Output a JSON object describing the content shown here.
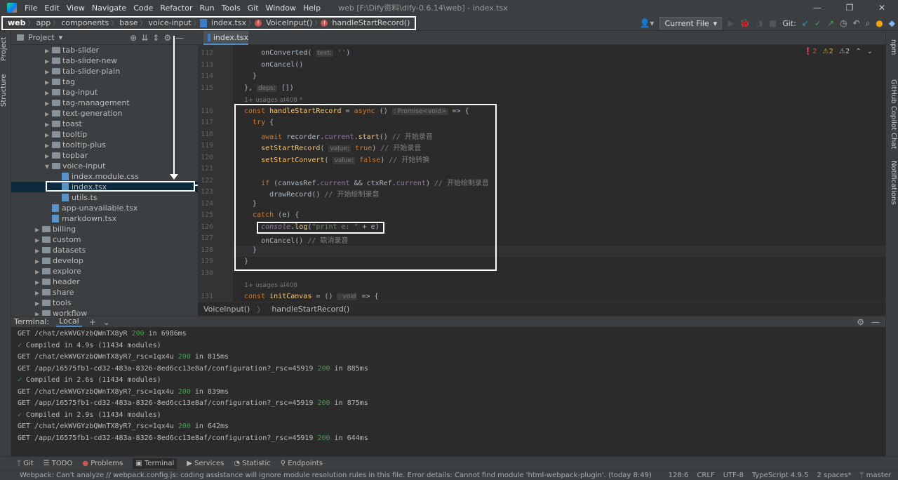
{
  "menu": [
    "File",
    "Edit",
    "View",
    "Navigate",
    "Code",
    "Refactor",
    "Run",
    "Tools",
    "Git",
    "Window",
    "Help"
  ],
  "window_title": "web [F:\\Dify资料\\dify-0.6.14\\web] - index.tsx",
  "breadcrumbs": {
    "web": "web",
    "app": "app",
    "components": "components",
    "base": "base",
    "voice": "voice-input",
    "file": "index.tsx",
    "fn1": "VoiceInput()",
    "fn2": "handleStartRecord()"
  },
  "nav_right": {
    "run_config": "Current File",
    "git_label": "Git:"
  },
  "project": {
    "header": "Project"
  },
  "tree": [
    {
      "label": "tab-slider",
      "type": "folder",
      "depth": 2
    },
    {
      "label": "tab-slider-new",
      "type": "folder",
      "depth": 2
    },
    {
      "label": "tab-slider-plain",
      "type": "folder",
      "depth": 2
    },
    {
      "label": "tag",
      "type": "folder",
      "depth": 2
    },
    {
      "label": "tag-input",
      "type": "folder",
      "depth": 2
    },
    {
      "label": "tag-management",
      "type": "folder",
      "depth": 2
    },
    {
      "label": "text-generation",
      "type": "folder",
      "depth": 2
    },
    {
      "label": "toast",
      "type": "folder",
      "depth": 2
    },
    {
      "label": "tooltip",
      "type": "folder",
      "depth": 2
    },
    {
      "label": "tooltip-plus",
      "type": "folder",
      "depth": 2
    },
    {
      "label": "topbar",
      "type": "folder",
      "depth": 2
    },
    {
      "label": "voice-input",
      "type": "folder-open",
      "depth": 2
    },
    {
      "label": "index.module.css",
      "type": "file",
      "depth": 3
    },
    {
      "label": "index.tsx",
      "type": "file",
      "depth": 3,
      "selected": true
    },
    {
      "label": "utils.ts",
      "type": "file",
      "depth": 3
    },
    {
      "label": "app-unavailable.tsx",
      "type": "file",
      "depth": 2
    },
    {
      "label": "markdown.tsx",
      "type": "file",
      "depth": 2
    },
    {
      "label": "billing",
      "type": "folder",
      "depth": 1
    },
    {
      "label": "custom",
      "type": "folder",
      "depth": 1
    },
    {
      "label": "datasets",
      "type": "folder",
      "depth": 1
    },
    {
      "label": "develop",
      "type": "folder",
      "depth": 1
    },
    {
      "label": "explore",
      "type": "folder",
      "depth": 1
    },
    {
      "label": "header",
      "type": "folder",
      "depth": 1
    },
    {
      "label": "share",
      "type": "folder",
      "depth": 1
    },
    {
      "label": "tools",
      "type": "folder",
      "depth": 1
    },
    {
      "label": "workflow",
      "type": "folder",
      "depth": 1
    }
  ],
  "editor": {
    "tab": "index.tsx",
    "inspections": {
      "errors": "2",
      "warn1": "2",
      "warn2": "2"
    },
    "lines": [
      {
        "n": "112",
        "html": "    onConverted( <span class=\"ip\">text:</span> <span class=\"str\">''</span>)"
      },
      {
        "n": "113",
        "html": "    onCancel()"
      },
      {
        "n": "114",
        "html": "  }"
      },
      {
        "n": "115",
        "html": "}, <span class=\"ip\">deps:</span> [])"
      },
      {
        "n": "",
        "meta": "1+ usages   ai408 *"
      },
      {
        "n": "116",
        "html": "<span class=\"kw\">const</span> <span class=\"fn\">handleStartRecord</span> = <span class=\"kw\">async</span> () <span class=\"ip\">: Promise&lt;void&gt;</span> => {"
      },
      {
        "n": "117",
        "html": "  <span class=\"kw\">try</span> {"
      },
      {
        "n": "118",
        "html": "    <span class=\"kw\">await</span> recorder.<span class=\"pr\">current</span>.<span class=\"fn\">start</span>() <span class=\"cm\">// 开始录音</span>"
      },
      {
        "n": "119",
        "html": "    <span class=\"fn\">setStartRecord</span>( <span class=\"ip\">value:</span> <span class=\"kw\">true</span>) <span class=\"cm\">// 开始录音</span>"
      },
      {
        "n": "120",
        "html": "    <span class=\"fn\">setStartConvert</span>( <span class=\"ip\">value:</span> <span class=\"kw\">false</span>) <span class=\"cm\">// 开始转换</span>"
      },
      {
        "n": "121",
        "html": ""
      },
      {
        "n": "122",
        "html": "    <span class=\"kw\">if</span> (canvasRef.<span class=\"pr\">current</span> && ctxRef.<span class=\"pr\">current</span>) <span class=\"cm\">// 开始绘制录音</span>"
      },
      {
        "n": "123",
        "html": "      drawRecord() <span class=\"cm\">// 开始绘制录音</span>"
      },
      {
        "n": "124",
        "html": "  }"
      },
      {
        "n": "125",
        "html": "  <span class=\"kw\">catch</span> (e) {"
      },
      {
        "n": "126",
        "html": "    <span class=\"pr\"><i>console</i></span>.<span class=\"fn\">log</span>(<span class=\"str\">\"print e: \"</span> + e)"
      },
      {
        "n": "127",
        "html": "    onCancel() <span class=\"cm\">// 取消录音</span>"
      },
      {
        "n": "128",
        "html": "  }"
      },
      {
        "n": "129",
        "html": "}"
      },
      {
        "n": "130",
        "html": ""
      },
      {
        "n": "",
        "meta": "1+ usages   ai408"
      },
      {
        "n": "131",
        "html": "<span class=\"kw\">const</span> <span class=\"fn\">initCanvas</span> = () <span class=\"ip\">: void</span> => {"
      }
    ],
    "crumb": [
      "VoiceInput()",
      "handleStartRecord()"
    ]
  },
  "terminal": {
    "title": "Terminal:",
    "tab": "Local",
    "lines": [
      {
        "t": "GET /chat/ekWVGYzbQWnTX8yR ",
        "s": "200",
        "e": " in 6986ms"
      },
      {
        "c": "Compiled in 4.9s (11434 modules)"
      },
      {
        "t": "GET /chat/ekWVGYzbQWnTX8yR?_rsc=1qx4u ",
        "s": "200",
        "e": " in 815ms"
      },
      {
        "t": "GET /app/16575fb1-cd32-483a-8326-8ed6cc13e8af/configuration?_rsc=45919 ",
        "s": "200",
        "e": " in 885ms"
      },
      {
        "c": "Compiled in 2.6s (11434 modules)"
      },
      {
        "t": "GET /chat/ekWVGYzbQWnTX8yR?_rsc=1qx4u ",
        "s": "200",
        "e": " in 839ms"
      },
      {
        "t": "GET /app/16575fb1-cd32-483a-8326-8ed6cc13e8af/configuration?_rsc=45919 ",
        "s": "200",
        "e": " in 875ms"
      },
      {
        "c": "Compiled in 2.9s (11434 modules)"
      },
      {
        "t": "GET /chat/ekWVGYzbQWnTX8yR?_rsc=1qx4u ",
        "s": "200",
        "e": " in 642ms"
      },
      {
        "t": "GET /app/16575fb1-cd32-483a-8326-8ed6cc13e8af/configuration?_rsc=45919 ",
        "s": "200",
        "e": " in 644ms"
      }
    ]
  },
  "toolwindows": [
    "Git",
    "TODO",
    "Problems",
    "Terminal",
    "Services",
    "Statistic",
    "Endpoints"
  ],
  "status": {
    "message": "Webpack: Can't analyze // webpack.config.js: coding assistance will ignore module resolution rules in this file. Error details: Cannot find module 'html-webpack-plugin'. (today 8:49)",
    "position": "128:6",
    "eol": "CRLF",
    "encoding": "UTF-8",
    "lang": "TypeScript 4.9.5",
    "indent": "2 spaces*",
    "branch": "master"
  },
  "side": {
    "project": "Project",
    "structure": "Structure",
    "copilot": "GitHub Copilot Chat",
    "notifications": "Notifications",
    "npm": "npm"
  },
  "colors": {
    "accent": "#4a88c7",
    "ok": "#499c54",
    "error": "#c75450"
  }
}
